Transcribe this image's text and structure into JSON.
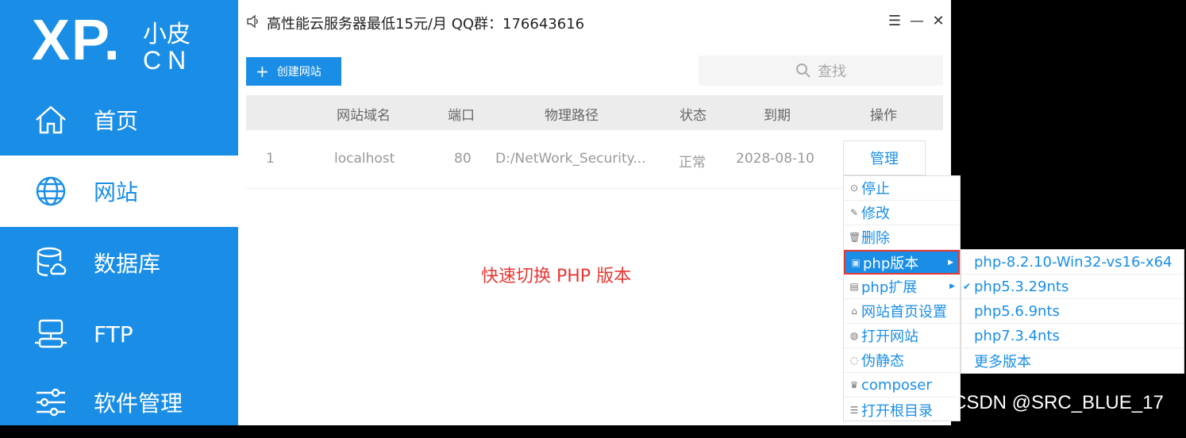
{
  "brand": {
    "logo_xp": "XP.",
    "logo_cn_top": "小皮",
    "logo_cn_bottom": "CN"
  },
  "sidebar": {
    "items": [
      {
        "label": "首页",
        "icon": "home-icon",
        "active": false
      },
      {
        "label": "网站",
        "icon": "globe-icon",
        "active": true
      },
      {
        "label": "数据库",
        "icon": "database-icon",
        "active": false
      },
      {
        "label": "FTP",
        "icon": "ftp-icon",
        "active": false
      },
      {
        "label": "软件管理",
        "icon": "sliders-icon",
        "active": false
      }
    ]
  },
  "window": {
    "title": "高性能云服务器最低15元/月  QQ群：176643616",
    "controls": [
      "menu",
      "minimize",
      "close"
    ]
  },
  "toolbar": {
    "create_label": "创建网站",
    "search_placeholder": "查找"
  },
  "table": {
    "headers": [
      "网站域名",
      "端口",
      "物理路径",
      "状态",
      "到期",
      "操作"
    ],
    "rows": [
      {
        "index": "1",
        "domain": "localhost",
        "port": "80",
        "path": "D:/NetWork_Security...",
        "status": "正常",
        "expiry": "2028-08-10",
        "action": "管理"
      }
    ]
  },
  "hint_text": "快速切换 PHP 版本",
  "context_menu": {
    "items": [
      {
        "icon": "stop-icon",
        "glyph": "⊙",
        "label": "停止"
      },
      {
        "icon": "edit-icon",
        "glyph": "✎",
        "label": "修改"
      },
      {
        "icon": "trash-icon",
        "glyph": "🗑",
        "label": "删除"
      },
      {
        "icon": "php-icon",
        "glyph": "▣",
        "label": "php版本",
        "submenu": true,
        "selected": true
      },
      {
        "icon": "extension-icon",
        "glyph": "▤",
        "label": "php扩展",
        "submenu": true
      },
      {
        "icon": "home-small-icon",
        "glyph": "⌂",
        "label": "网站首页设置"
      },
      {
        "icon": "globe-small-icon",
        "glyph": "◍",
        "label": "打开网站"
      },
      {
        "icon": "rewrite-icon",
        "glyph": "◌",
        "label": "伪静态"
      },
      {
        "icon": "composer-icon",
        "glyph": "♛",
        "label": "composer"
      },
      {
        "icon": "folder-list-icon",
        "glyph": "☰",
        "label": "打开根目录"
      }
    ]
  },
  "php_versions": {
    "items": [
      {
        "label": "php-8.2.10-Win32-vs16-x64",
        "checked": false
      },
      {
        "label": "php5.3.29nts",
        "checked": true
      },
      {
        "label": "php5.6.9nts",
        "checked": false
      },
      {
        "label": "php7.3.4nts",
        "checked": false
      },
      {
        "label": "更多版本",
        "checked": false
      }
    ]
  },
  "watermark": "CSDN @SRC_BLUE_17",
  "colors": {
    "accent": "#1a8ee6",
    "highlight": "#e53935"
  }
}
